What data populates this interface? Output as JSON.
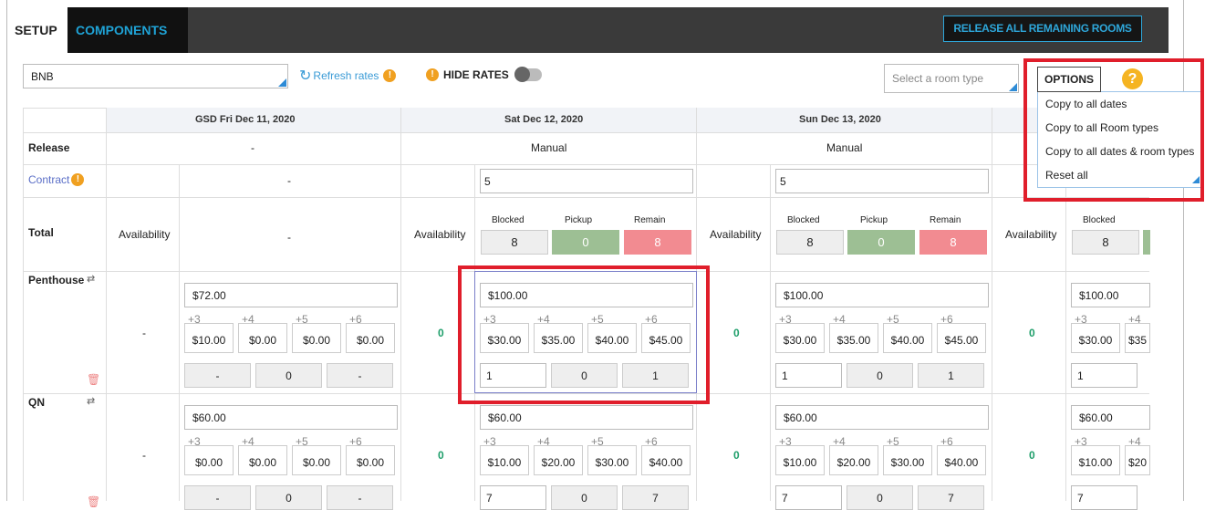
{
  "tabs": {
    "setup": "SETUP",
    "components": "COMPONENTS"
  },
  "release_all_label": "RELEASE ALL REMAINING ROOMS",
  "board_select": {
    "value": "BNB"
  },
  "refresh_rates_label": "Refresh rates",
  "hide_rates_label": "HIDE RATES",
  "room_type_select": {
    "placeholder": "Select a room type"
  },
  "options": {
    "label": "OPTIONS",
    "help_glyph": "?",
    "items": [
      "Copy to all dates",
      "Copy to all Room types",
      "Copy to all dates & room types",
      "Reset all"
    ]
  },
  "row_labels": {
    "release": "Release",
    "contract": "Contract",
    "total": "Total",
    "availability": "Availability"
  },
  "stat_labels": {
    "blocked": "Blocked",
    "pickup": "Pickup",
    "remain": "Remain"
  },
  "dates": [
    {
      "header": "GSD  Fri  Dec 11, 2020",
      "release": "-",
      "contract": "-",
      "total": "-"
    },
    {
      "header": "Sat  Dec 12, 2020",
      "release": "Manual",
      "contract": "5",
      "blocked": "8",
      "pickup": "0",
      "remain": "8"
    },
    {
      "header": "Sun  Dec 13, 2020",
      "release": "Manual",
      "contract": "5",
      "blocked": "8",
      "pickup": "0",
      "remain": "8"
    },
    {
      "blocked": "8"
    }
  ],
  "rooms": [
    {
      "name": "Penthouse",
      "availability": [
        "-",
        "0",
        "0",
        "0"
      ],
      "cells": [
        {
          "price": "$72.00",
          "extras": [
            "$10.00",
            "$0.00",
            "$0.00",
            "$0.00"
          ],
          "bottom": [
            "-",
            "0",
            "-"
          ]
        },
        {
          "price": "$100.00",
          "extras": [
            "$30.00",
            "$35.00",
            "$40.00",
            "$45.00"
          ],
          "bottom": [
            "1",
            "0",
            "1"
          ]
        },
        {
          "price": "$100.00",
          "extras": [
            "$30.00",
            "$35.00",
            "$40.00",
            "$45.00"
          ],
          "bottom": [
            "1",
            "0",
            "1"
          ]
        },
        {
          "price": "$100.00",
          "extras": [
            "$30.00",
            "$35"
          ],
          "bottom": [
            "1"
          ]
        }
      ]
    },
    {
      "name": "QN",
      "availability": [
        "-",
        "0",
        "0",
        "0"
      ],
      "cells": [
        {
          "price": "$60.00",
          "extras": [
            "$0.00",
            "$0.00",
            "$0.00",
            "$0.00"
          ],
          "bottom": [
            "-",
            "0",
            "-"
          ]
        },
        {
          "price": "$60.00",
          "extras": [
            "$10.00",
            "$20.00",
            "$30.00",
            "$40.00"
          ],
          "bottom": [
            "7",
            "0",
            "7"
          ]
        },
        {
          "price": "$60.00",
          "extras": [
            "$10.00",
            "$20.00",
            "$30.00",
            "$40.00"
          ],
          "bottom": [
            "7",
            "0",
            "7"
          ]
        },
        {
          "price": "$60.00",
          "extras": [
            "$10.00",
            "$20"
          ],
          "bottom": [
            "7"
          ]
        }
      ]
    }
  ],
  "extra_labels": [
    "+3",
    "+4",
    "+5",
    "+6"
  ],
  "colors": {
    "accent": "#1fa3d6",
    "pickup_green": "#9dbf94",
    "remain_red": "#f28b91",
    "highlight": "#e01e2b"
  }
}
